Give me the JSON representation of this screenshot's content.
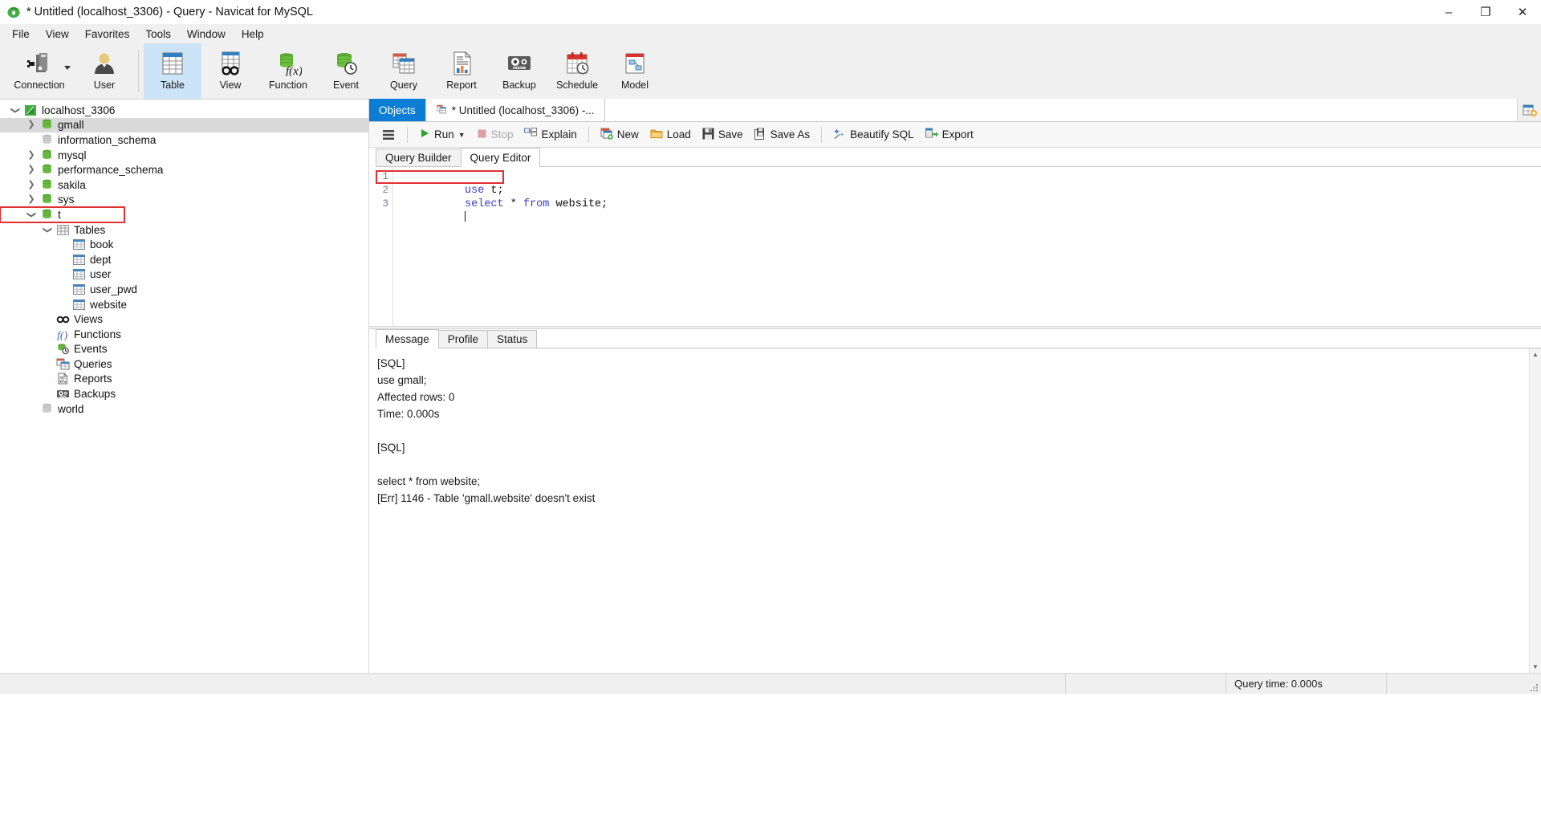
{
  "window": {
    "title": "* Untitled (localhost_3306) - Query - Navicat for MySQL",
    "logo_icon": "navicat-leaf-icon",
    "minimize_label": "–",
    "maximize_label": "❐",
    "close_label": "✕"
  },
  "menubar": {
    "items": [
      {
        "label": "File"
      },
      {
        "label": "View"
      },
      {
        "label": "Favorites"
      },
      {
        "label": "Tools"
      },
      {
        "label": "Window"
      },
      {
        "label": "Help"
      }
    ]
  },
  "toolbar": {
    "buttons": [
      {
        "label": "Connection",
        "icon": "connection-icon",
        "has_caret": true,
        "active": false
      },
      {
        "label": "User",
        "icon": "user-icon",
        "has_caret": false,
        "active": false
      },
      {
        "label": "Table",
        "icon": "table-icon",
        "has_caret": false,
        "active": true
      },
      {
        "label": "View",
        "icon": "view-glasses-icon",
        "has_caret": false,
        "active": false
      },
      {
        "label": "Function",
        "icon": "function-fx-icon",
        "has_caret": false,
        "active": false
      },
      {
        "label": "Event",
        "icon": "event-clock-icon",
        "has_caret": false,
        "active": false
      },
      {
        "label": "Query",
        "icon": "query-icon",
        "has_caret": false,
        "active": false
      },
      {
        "label": "Report",
        "icon": "report-icon",
        "has_caret": false,
        "active": false
      },
      {
        "label": "Backup",
        "icon": "backup-tape-icon",
        "has_caret": false,
        "active": false
      },
      {
        "label": "Schedule",
        "icon": "schedule-calendar-icon",
        "has_caret": false,
        "active": false
      },
      {
        "label": "Model",
        "icon": "model-icon",
        "has_caret": false,
        "active": false
      }
    ]
  },
  "sidebar": {
    "nodes": [
      {
        "label": "localhost_3306",
        "indent": 0,
        "twisty": "down",
        "icon": "connection-leaf-icon",
        "selected": false,
        "boxed": false
      },
      {
        "label": "gmall",
        "indent": 1,
        "twisty": "right",
        "icon": "database-icon",
        "selected": true,
        "boxed": false
      },
      {
        "label": "information_schema",
        "indent": 1,
        "twisty": "none",
        "icon": "database-gray-icon",
        "selected": false,
        "boxed": false
      },
      {
        "label": "mysql",
        "indent": 1,
        "twisty": "right",
        "icon": "database-icon",
        "selected": false,
        "boxed": false
      },
      {
        "label": "performance_schema",
        "indent": 1,
        "twisty": "right",
        "icon": "database-icon",
        "selected": false,
        "boxed": false
      },
      {
        "label": "sakila",
        "indent": 1,
        "twisty": "right",
        "icon": "database-icon",
        "selected": false,
        "boxed": false
      },
      {
        "label": "sys",
        "indent": 1,
        "twisty": "right",
        "icon": "database-icon",
        "selected": false,
        "boxed": false
      },
      {
        "label": "t",
        "indent": 1,
        "twisty": "down",
        "icon": "database-icon",
        "selected": false,
        "boxed": true
      },
      {
        "label": "Tables",
        "indent": 2,
        "twisty": "down",
        "icon": "tables-folder-icon",
        "selected": false,
        "boxed": false
      },
      {
        "label": "book",
        "indent": 3,
        "twisty": "none",
        "icon": "table-small-icon",
        "selected": false,
        "boxed": false
      },
      {
        "label": "dept",
        "indent": 3,
        "twisty": "none",
        "icon": "table-small-icon",
        "selected": false,
        "boxed": false
      },
      {
        "label": "user",
        "indent": 3,
        "twisty": "none",
        "icon": "table-small-icon",
        "selected": false,
        "boxed": false
      },
      {
        "label": "user_pwd",
        "indent": 3,
        "twisty": "none",
        "icon": "table-small-icon",
        "selected": false,
        "boxed": false
      },
      {
        "label": "website",
        "indent": 3,
        "twisty": "none",
        "icon": "table-small-icon",
        "selected": false,
        "boxed": false
      },
      {
        "label": "Views",
        "indent": 2,
        "twisty": "none",
        "icon": "view-glasses-icon",
        "selected": false,
        "boxed": false
      },
      {
        "label": "Functions",
        "indent": 2,
        "twisty": "none",
        "icon": "function-fx-icon",
        "selected": false,
        "boxed": false
      },
      {
        "label": "Events",
        "indent": 2,
        "twisty": "none",
        "icon": "event-clock-icon",
        "selected": false,
        "boxed": false
      },
      {
        "label": "Queries",
        "indent": 2,
        "twisty": "none",
        "icon": "query-icon",
        "selected": false,
        "boxed": false
      },
      {
        "label": "Reports",
        "indent": 2,
        "twisty": "none",
        "icon": "report-icon",
        "selected": false,
        "boxed": false
      },
      {
        "label": "Backups",
        "indent": 2,
        "twisty": "none",
        "icon": "backup-tape-icon",
        "selected": false,
        "boxed": false
      },
      {
        "label": "world",
        "indent": 1,
        "twisty": "none",
        "icon": "database-gray-icon",
        "selected": false,
        "boxed": false
      }
    ]
  },
  "tabstrip": {
    "objects_tab": "Objects",
    "query_tab": "* Untitled (localhost_3306) -...",
    "query_tab_icon": "query-icon",
    "new_tab_icon": "new-tab-plus-icon"
  },
  "query_toolbar": {
    "menu_icon": "hamburger-menu-icon",
    "run": "Run",
    "run_icon": "play-triangle-icon",
    "run_has_caret": true,
    "stop": "Stop",
    "stop_icon": "stop-square-icon",
    "stop_disabled": true,
    "explain": "Explain",
    "explain_icon": "explain-icon",
    "new": "New",
    "new_icon": "new-doc-icon",
    "load": "Load",
    "load_icon": "folder-icon",
    "save": "Save",
    "save_icon": "floppy-disk-icon",
    "save_as": "Save As",
    "save_as_icon": "save-as-icon",
    "beautify": "Beautify SQL",
    "beautify_icon": "sparkle-wand-icon",
    "export": "Export",
    "export_icon": "export-arrow-icon"
  },
  "editor_tabs": {
    "builder": "Query Builder",
    "editor": "Query Editor"
  },
  "editor": {
    "line_numbers": [
      "1",
      "2",
      "3"
    ],
    "lines": [
      {
        "num": "1",
        "kw1": "use",
        "rest": " t;",
        "boxed": true
      },
      {
        "num": "2",
        "kw1": "select",
        "mid": " * ",
        "kw2": "from",
        "rest": " website;",
        "boxed": false
      },
      {
        "num": "3",
        "kw1": "",
        "rest": "",
        "boxed": false
      }
    ]
  },
  "result_tabs": {
    "items": [
      {
        "label": "Message",
        "active": true
      },
      {
        "label": "Profile",
        "active": false
      },
      {
        "label": "Status",
        "active": false
      }
    ]
  },
  "message_panel": {
    "text": "[SQL]\nuse gmall;\nAffected rows: 0\nTime: 0.000s\n\n[SQL]\n\nselect * from website;\n[Err] 1146 - Table 'gmall.website' doesn't exist"
  },
  "statusbar": {
    "query_time": "Query time: 0.000s"
  },
  "colors": {
    "accent_blue": "#0b7dd4",
    "active_tool_bg": "#cce4f7",
    "annotation_red": "#e03030",
    "keyword_blue": "#3b3bd0",
    "db_green": "#5aa832"
  }
}
